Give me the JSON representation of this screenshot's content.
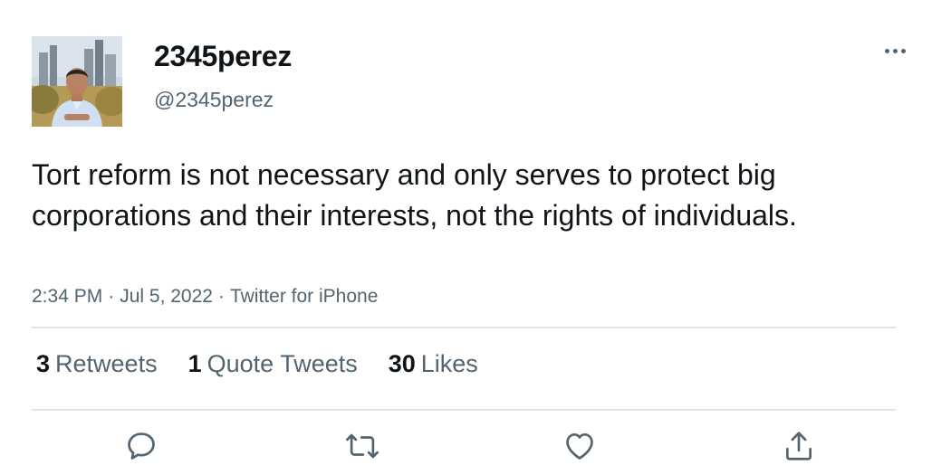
{
  "user": {
    "display_name": "2345perez",
    "handle": "@2345perez"
  },
  "tweet": {
    "text": "Tort reform is not necessary and only serves to protect big corporations and their interests, not the rights of individuals.",
    "time": "2:34 PM",
    "date": "Jul 5, 2022",
    "source": "Twitter for iPhone",
    "separator": "·"
  },
  "stats": {
    "retweets": {
      "count": "3",
      "label": "Retweets"
    },
    "quotes": {
      "count": "1",
      "label": "Quote Tweets"
    },
    "likes": {
      "count": "30",
      "label": "Likes"
    }
  },
  "actions": [
    "reply-icon",
    "retweet-icon",
    "like-icon",
    "share-icon"
  ],
  "colors": {
    "text": "#0f1419",
    "secondary": "#536471",
    "divider": "#e1e5e8"
  }
}
